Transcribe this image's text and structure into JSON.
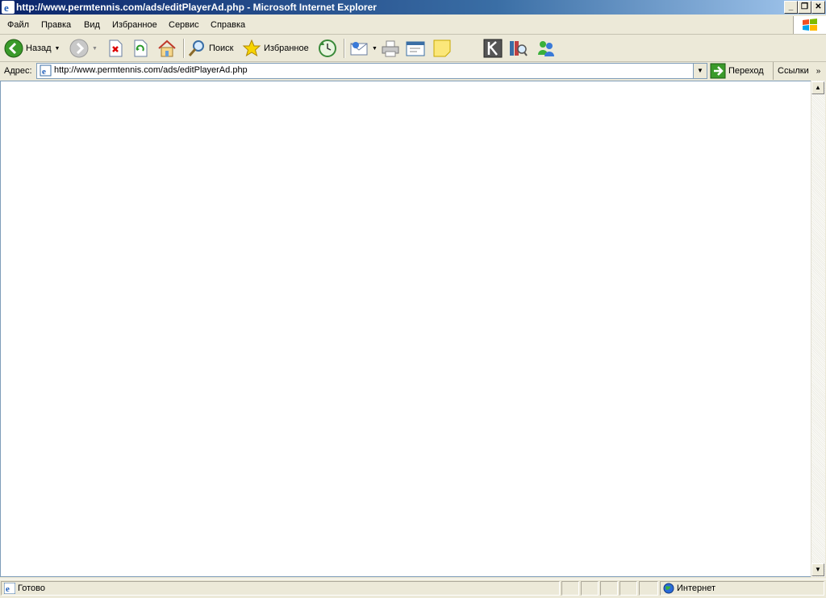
{
  "window": {
    "title": "http://www.permtennis.com/ads/editPlayerAd.php - Microsoft Internet Explorer",
    "controls": [
      "_",
      "❐",
      "✕"
    ]
  },
  "menu": [
    {
      "label": "Файл"
    },
    {
      "label": "Правка"
    },
    {
      "label": "Вид"
    },
    {
      "label": "Избранное"
    },
    {
      "label": "Сервис"
    },
    {
      "label": "Справка"
    }
  ],
  "toolbar": {
    "back_label": "Назад",
    "search_label": "Поиск",
    "favorites_label": "Избранное"
  },
  "address": {
    "label": "Адрес:",
    "url": "http://www.permtennis.com/ads/editPlayerAd.php",
    "go_label": "Переход",
    "links_label": "Ссылки"
  },
  "status": {
    "text": "Готово",
    "zone": "Интернет"
  },
  "colors": {
    "title_bar": "#0a246a",
    "chrome": "#ece9d8"
  }
}
